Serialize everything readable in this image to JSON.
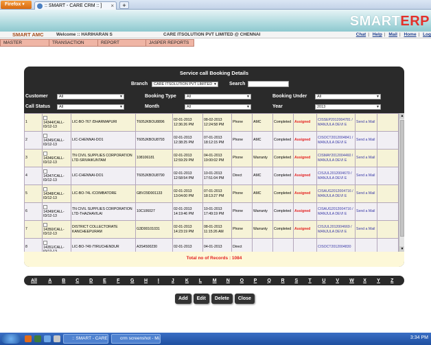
{
  "browser": {
    "menu_label": "Firefox",
    "tab_title": ":: SMART - CARE CRM :: ]"
  },
  "brand": {
    "logo_main": "SMART",
    "logo_accent": "ERP"
  },
  "info": {
    "amc": "SMART AMC",
    "welcome": "Welcome :: HARIHARAN S",
    "company": "CARE ITSOLUTION PVT LIMITED @ CHENNAI",
    "links": [
      "Chat",
      "Help",
      "Mail",
      "Home",
      "Log"
    ]
  },
  "menu": [
    "MASTER",
    "TRANSACTION",
    "REPORT",
    "JASPER REPORTS"
  ],
  "panel": {
    "title": "Service call Booking Details",
    "branch_label": "Branch",
    "branch_value": "CARE ITSOLUTION PVT LIMITED",
    "search_label": "Search",
    "customer_label": "Customer",
    "customer_value": "All",
    "booking_type_label": "Booking Type",
    "booking_type_value": "All",
    "booking_under_label": "Booking Under",
    "booking_under_value": "All",
    "call_status_label": "Call Status",
    "call_status_value": "All",
    "month_label": "Month",
    "month_value": "All",
    "year_label": "Year",
    "year_value": "2013"
  },
  "rows": [
    {
      "no": "1",
      "call": "14344/CALL-ID/12-13",
      "customer": "LIC-BO-767 /DHARMAPURI",
      "serial": "T605JKBOU8896",
      "booked": "02-01-2013 12:36:26 PM",
      "closed": "08-02-2013 12:24:58 PM",
      "mode": "Phone",
      "type": "AMC",
      "status": "Completed",
      "assign": "Assigned",
      "ticket": "CISSEP2012004781 / MANJULA DEVI E",
      "mail": "Send a Mail"
    },
    {
      "no": "2",
      "call": "14345/CALL-ID/12-13",
      "customer": "LIC-CHENNAI-DO1",
      "serial": "T605JKBOU8793",
      "booked": "02-01-2013 12:38:25 PM",
      "closed": "07-01-2013 18:12:15 PM",
      "mode": "Phone",
      "type": "AMC",
      "status": "Completed",
      "assign": "Assigned",
      "ticket": "CISOCT2012004841 / MANJULA DEVI E",
      "mail": "Send a Mail"
    },
    {
      "no": "3",
      "call": "14346/CALL-ID/12-13",
      "customer": "TN CIVIL SUPPLIES CORPORATION LTD-SRIVAIKUNTAM",
      "serial": "108106181",
      "booked": "02-01-2013 12:59:29 PM",
      "closed": "04-01-2013 19:00:02 PM",
      "mode": "Phone",
      "type": "Warranty",
      "status": "Completed",
      "assign": "Assigned",
      "ticket": "CISMAY2012004460 / MANJULA DEVI E",
      "mail": "Send a Mail"
    },
    {
      "no": "4",
      "call": "14347/CALL-ID/12-13",
      "customer": "LIC-CHENNAI-DO1",
      "serial": "T605JKBOU8790",
      "booked": "02-01-2013 12:58:54 PM",
      "closed": "10-01-2013 17:51:04 PM",
      "mode": "Direct",
      "type": "AMC",
      "status": "Completed",
      "assign": "Assigned",
      "ticket": "CISJUL2012004670 / MANJULA DEVI E",
      "mail": "Send a Mail"
    },
    {
      "no": "5",
      "call": "14348/CALL-ID/12-13",
      "customer": "LIC-BO-74L /COIMBATORE",
      "serial": "GBV29D001133",
      "booked": "02-01-2013 13:04:00 PM",
      "closed": "07-01-2013 18:13:27 PM",
      "mode": "Phone",
      "type": "AMC",
      "status": "Completed",
      "assign": "Assigned",
      "ticket": "CISAUG2012004716 / MANJULA DEVI E",
      "mail": "Send a Mail"
    },
    {
      "no": "6",
      "call": "14349/CALL-ID/12-13",
      "customer": "TN CIVIL SUPPLIES CORPORATION LTD-THAZHAVILAI",
      "serial": "10C106027",
      "booked": "02-01-2013 14:19:46 PM",
      "closed": "10-01-2013 17:49:19 PM",
      "mode": "Phone",
      "type": "Warranty",
      "status": "Completed",
      "assign": "Assigned",
      "ticket": "CISAUG2012004716 / MANJULA DEVI E",
      "mail": "Send a Mail"
    },
    {
      "no": "7",
      "call": "14350/CALL-ID/12-13",
      "customer": "DISTRICT COLLECTORATE KANCHEEPURAM",
      "serial": "G3D00101031",
      "booked": "02-01-2013 14:23:19 PM",
      "closed": "08-01-2013 11:15:26 AM",
      "mode": "Phone",
      "type": "Warranty",
      "status": "Completed",
      "assign": "Assigned",
      "ticket": "CISJUL2012004669 / MANJULA DEVI E",
      "mail": "Send a Mail"
    },
    {
      "no": "8",
      "call": "14351/CALL-ID/12-13",
      "customer": "LIC-BO-749 /TIRUCHENDUR",
      "serial": "A3S4500230",
      "booked": "02-01-2013",
      "closed": "04-01-2013",
      "mode": "Direct",
      "type": "",
      "status": "",
      "assign": "",
      "ticket": "CISOCT2012004830",
      "mail": ""
    }
  ],
  "total": "Total no of Records : 1084",
  "alphabet": [
    "All",
    "A",
    "B",
    "C",
    "D",
    "E",
    "F",
    "G",
    "H",
    "I",
    "J",
    "K",
    "L",
    "M",
    "N",
    "O",
    "P",
    "Q",
    "R",
    "S",
    "T",
    "U",
    "V",
    "W",
    "X",
    "Y",
    "Z"
  ],
  "buttons": [
    "Add",
    "Edit",
    "Delete",
    "Close"
  ],
  "taskbar": {
    "task1": ":: SMART - CARE C...",
    "task2": "crm screenshot - Mi...",
    "clock": "3:34 PM"
  }
}
